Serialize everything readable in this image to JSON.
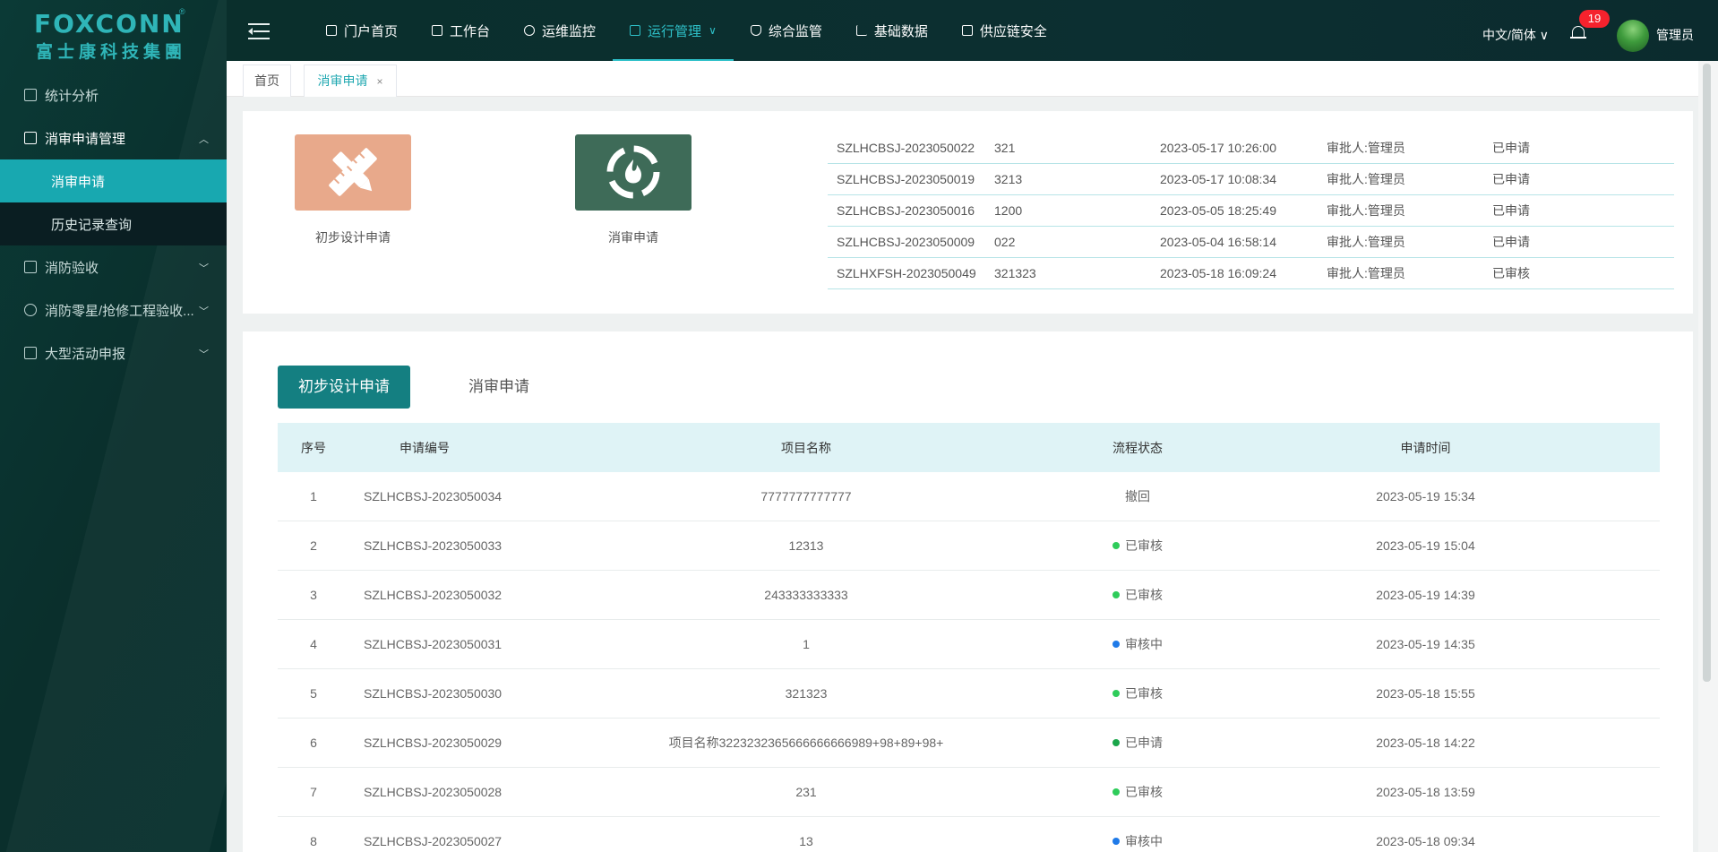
{
  "brand": {
    "en": "FOXCONN",
    "cn": "富士康科技集團",
    "reg": "®"
  },
  "sidebar": {
    "items": [
      {
        "label": "统计分析",
        "icon": "report-icon"
      },
      {
        "label": "消审申请管理",
        "icon": "form-icon",
        "expanded": true,
        "children": [
          {
            "label": "消审申请",
            "active": true
          },
          {
            "label": "历史记录查询"
          }
        ]
      },
      {
        "label": "消防验收",
        "icon": "form-icon"
      },
      {
        "label": "消防零星/抢修工程验收...",
        "icon": "wrench-icon"
      },
      {
        "label": "大型活动申报",
        "icon": "calendar-icon"
      }
    ]
  },
  "header": {
    "nav": [
      {
        "label": "门户首页",
        "icon": "monitor-icon"
      },
      {
        "label": "工作台",
        "icon": "grid-icon"
      },
      {
        "label": "运维监控",
        "icon": "gear-icon"
      },
      {
        "label": "运行管理",
        "icon": "chart-icon",
        "active": true,
        "dropdown": "∨"
      },
      {
        "label": "综合监管",
        "icon": "shield-icon"
      },
      {
        "label": "基础数据",
        "icon": "bar-chart-icon"
      },
      {
        "label": "供应链安全",
        "icon": "chart-icon"
      }
    ],
    "language": "中文/简体 ∨",
    "notification_count": "19",
    "user_name": "管理员"
  },
  "tabs": [
    {
      "label": "首页"
    },
    {
      "label": "消审申请",
      "close": "×"
    }
  ],
  "shortcuts": [
    {
      "label": "初步设计申请",
      "icon": "ruler-pencil-icon"
    },
    {
      "label": "消审申请",
      "icon": "fire-emblem-icon"
    }
  ],
  "recent_records": [
    {
      "no": "SZLHCBSJ-2023050022",
      "project": "321",
      "time": "2023-05-17 10:26:00",
      "approver": "审批人:管理员",
      "status": "已申请"
    },
    {
      "no": "SZLHCBSJ-2023050019",
      "project": "3213",
      "time": "2023-05-17 10:08:34",
      "approver": "审批人:管理员",
      "status": "已申请"
    },
    {
      "no": "SZLHCBSJ-2023050016",
      "project": "1200",
      "time": "2023-05-05 18:25:49",
      "approver": "审批人:管理员",
      "status": "已申请"
    },
    {
      "no": "SZLHCBSJ-2023050009",
      "project": "022",
      "time": "2023-05-04 16:58:14",
      "approver": "审批人:管理员",
      "status": "已申请"
    },
    {
      "no": "SZLHXFSH-2023050049",
      "project": "321323",
      "time": "2023-05-18 16:09:24",
      "approver": "审批人:管理员",
      "status": "已审核"
    }
  ],
  "segment": {
    "active": "初步设计申请",
    "inactive": "消审申请"
  },
  "table": {
    "columns": [
      "序号",
      "申请编号",
      "项目名称",
      "流程状态",
      "申请时间"
    ],
    "rows": [
      {
        "idx": "1",
        "no": "SZLHCBSJ-2023050034",
        "name": "7777777777777",
        "status": "撤回",
        "dot": "",
        "time": "2023-05-19 15:34"
      },
      {
        "idx": "2",
        "no": "SZLHCBSJ-2023050033",
        "name": "12313",
        "status": "已审核",
        "dot": "#2ecc5a",
        "time": "2023-05-19 15:04"
      },
      {
        "idx": "3",
        "no": "SZLHCBSJ-2023050032",
        "name": "243333333333",
        "status": "已审核",
        "dot": "#2ecc5a",
        "time": "2023-05-19 14:39"
      },
      {
        "idx": "4",
        "no": "SZLHCBSJ-2023050031",
        "name": "1",
        "status": "审核中",
        "dot": "#1f7ae8",
        "time": "2023-05-19 14:35"
      },
      {
        "idx": "5",
        "no": "SZLHCBSJ-2023050030",
        "name": "321323",
        "status": "已审核",
        "dot": "#2ecc5a",
        "time": "2023-05-18 15:55"
      },
      {
        "idx": "6",
        "no": "SZLHCBSJ-2023050029",
        "name": "项目名称3223232365666666666989+98+89+98+",
        "status": "已申请",
        "dot": "#1aa64a",
        "time": "2023-05-18 14:22"
      },
      {
        "idx": "7",
        "no": "SZLHCBSJ-2023050028",
        "name": "231",
        "status": "已审核",
        "dot": "#2ecc5a",
        "time": "2023-05-18 13:59"
      },
      {
        "idx": "8",
        "no": "SZLHCBSJ-2023050027",
        "name": "13",
        "status": "审核中",
        "dot": "#1f7ae8",
        "time": "2023-05-18 09:34"
      }
    ]
  },
  "colors": {
    "accent": "#1ea7b0",
    "primary_button": "#147f81",
    "sidebar_bg": "#0a2f2c",
    "badge": "#f5222d"
  }
}
